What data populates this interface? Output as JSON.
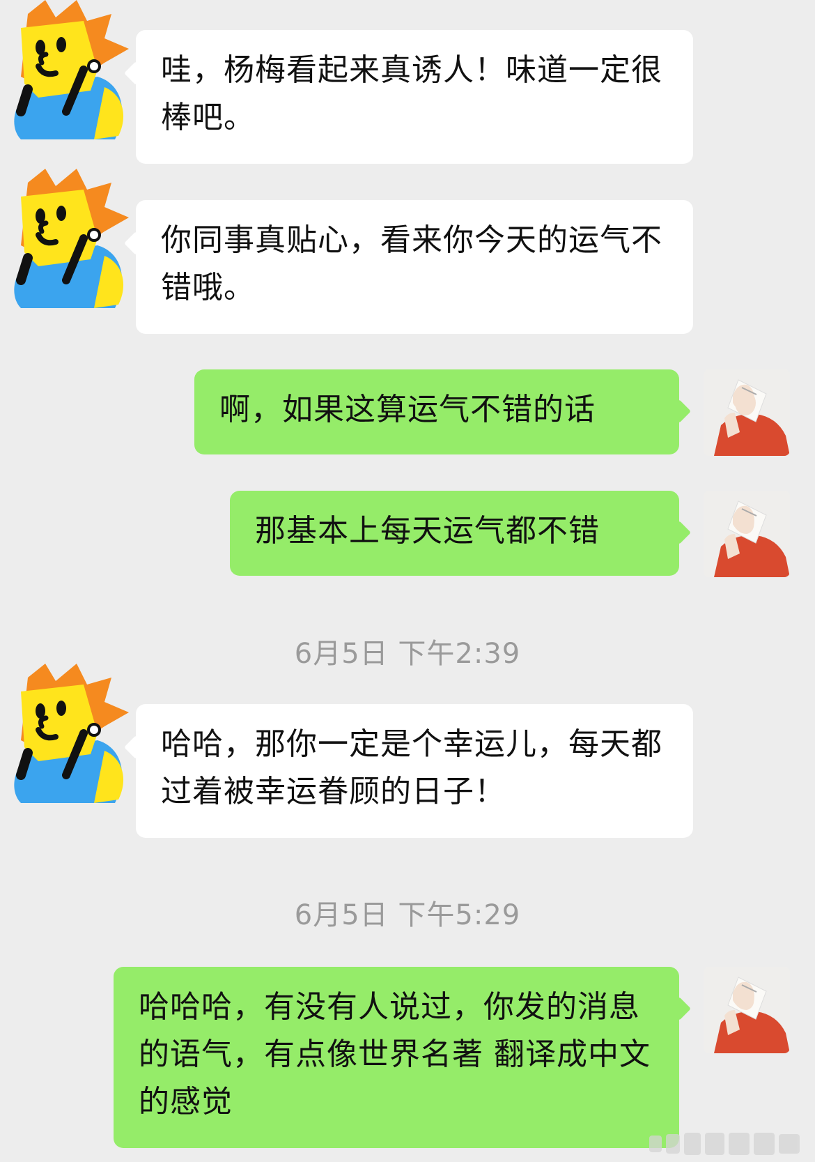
{
  "chat": {
    "messages": [
      {
        "side": "left",
        "text": "哇，杨梅看起来真诱人！味道一定很棒吧。"
      },
      {
        "side": "left",
        "text": "你同事真贴心，看来你今天的运气不错哦。"
      },
      {
        "side": "right",
        "text": "啊，如果这算运气不错的话"
      },
      {
        "side": "right",
        "text": "那基本上每天运气都不错"
      },
      {
        "side": "left",
        "text": "哈哈，那你一定是个幸运儿，每天都过着被幸运眷顾的日子！"
      },
      {
        "side": "right",
        "text": "哈哈哈，有没有人说过，你发的消息的语气，有点像世界名著 翻译成中文的感觉"
      }
    ],
    "timestamps": [
      "6月5日 下午2:39",
      "6月5日 下午5:29"
    ]
  },
  "colors": {
    "background": "#ededed",
    "left_bubble": "#ffffff",
    "right_bubble": "#95ec69",
    "timestamp_text": "#9a9a9a"
  },
  "icons": {
    "left_avatar": "cartoon-character-avatar",
    "right_avatar": "photo-avatar-red-shirt"
  }
}
